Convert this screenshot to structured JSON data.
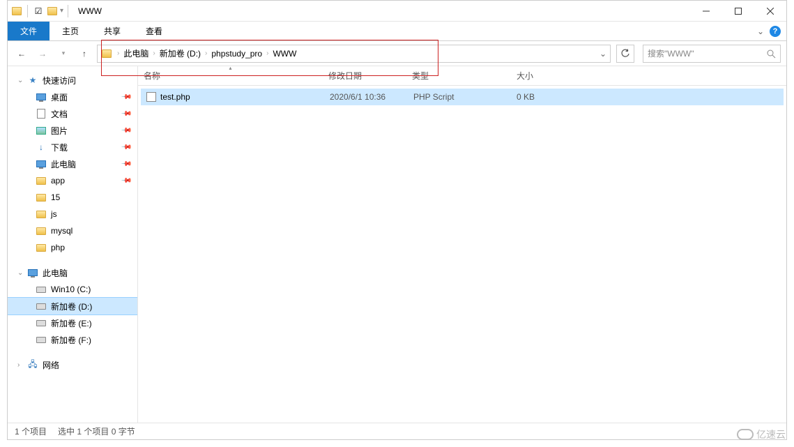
{
  "title": "WWW",
  "ribbon": {
    "file": "文件",
    "home": "主页",
    "share": "共享",
    "view": "查看"
  },
  "breadcrumb": [
    "此电脑",
    "新加卷 (D:)",
    "phpstudy_pro",
    "WWW"
  ],
  "search_placeholder": "搜索\"WWW\"",
  "sidebar": {
    "quick_access": "快速访问",
    "pinned": [
      {
        "label": "桌面",
        "icon": "monitor"
      },
      {
        "label": "文档",
        "icon": "doc"
      },
      {
        "label": "图片",
        "icon": "pic"
      },
      {
        "label": "下载",
        "icon": "dl"
      },
      {
        "label": "此电脑",
        "icon": "monitor"
      },
      {
        "label": "app",
        "icon": "folder"
      },
      {
        "label": "15",
        "icon": "folder"
      },
      {
        "label": "js",
        "icon": "folder"
      },
      {
        "label": "mysql",
        "icon": "folder"
      },
      {
        "label": "php",
        "icon": "folder"
      }
    ],
    "this_pc": "此电脑",
    "drives": [
      {
        "label": "Win10 (C:)"
      },
      {
        "label": "新加卷 (D:)",
        "selected": true
      },
      {
        "label": "新加卷 (E:)"
      },
      {
        "label": "新加卷 (F:)"
      }
    ],
    "network": "网络"
  },
  "columns": {
    "name": "名称",
    "date": "修改日期",
    "type": "类型",
    "size": "大小"
  },
  "files": [
    {
      "name": "test.php",
      "date": "2020/6/1 10:36",
      "type": "PHP Script",
      "size": "0 KB",
      "selected": true
    }
  ],
  "status": {
    "count": "1 个项目",
    "selected": "选中 1 个项目  0 字节"
  },
  "watermark": "亿速云"
}
